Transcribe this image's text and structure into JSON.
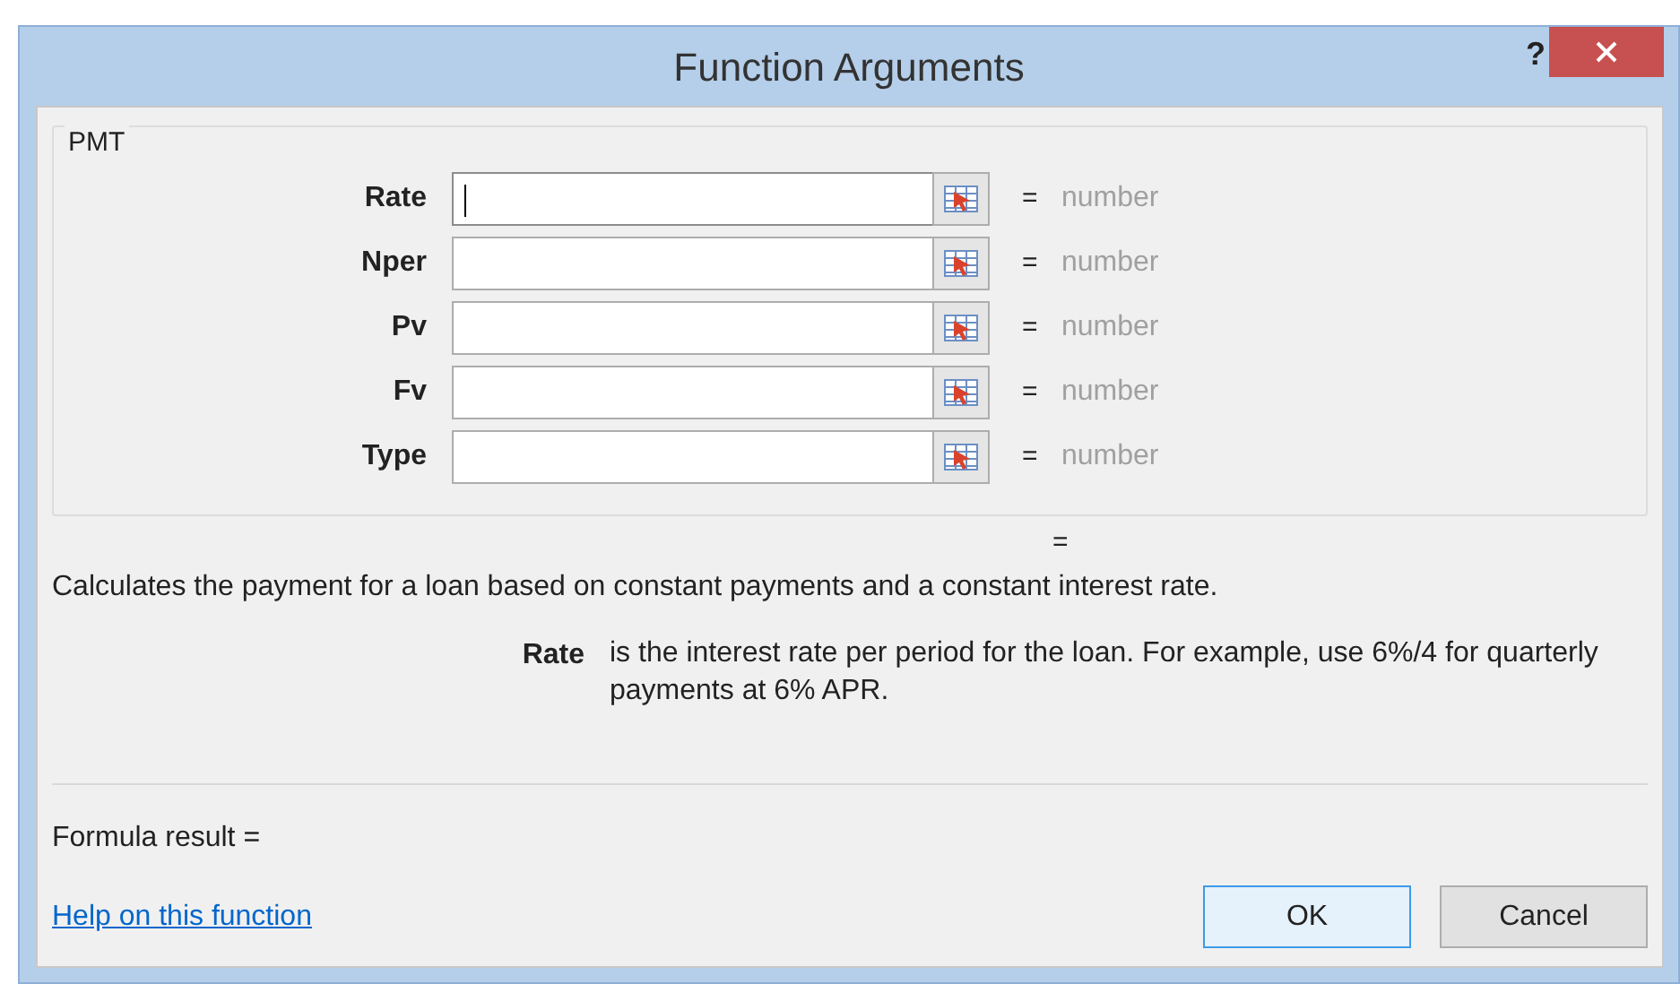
{
  "window": {
    "title": "Function Arguments",
    "help": "?"
  },
  "group": {
    "legend": "PMT"
  },
  "arguments": [
    {
      "label": "Rate",
      "focused": true,
      "result": "number"
    },
    {
      "label": "Nper",
      "focused": false,
      "result": "number"
    },
    {
      "label": "Pv",
      "focused": false,
      "result": "number"
    },
    {
      "label": "Fv",
      "focused": false,
      "result": "number"
    },
    {
      "label": "Type",
      "focused": false,
      "result": "number"
    }
  ],
  "equals": "=",
  "function_result": "=",
  "description": "Calculates the payment for a loan based on constant payments and a constant interest rate.",
  "argument_help": {
    "name": "Rate",
    "text": "is the interest rate per period for the loan. For example, use 6%/4 for quarterly payments at 6% APR."
  },
  "formula_result": "Formula result =",
  "help_link": "Help on this function",
  "buttons": [
    {
      "label": "OK",
      "focused": true
    },
    {
      "label": "Cancel",
      "focused": false
    }
  ]
}
